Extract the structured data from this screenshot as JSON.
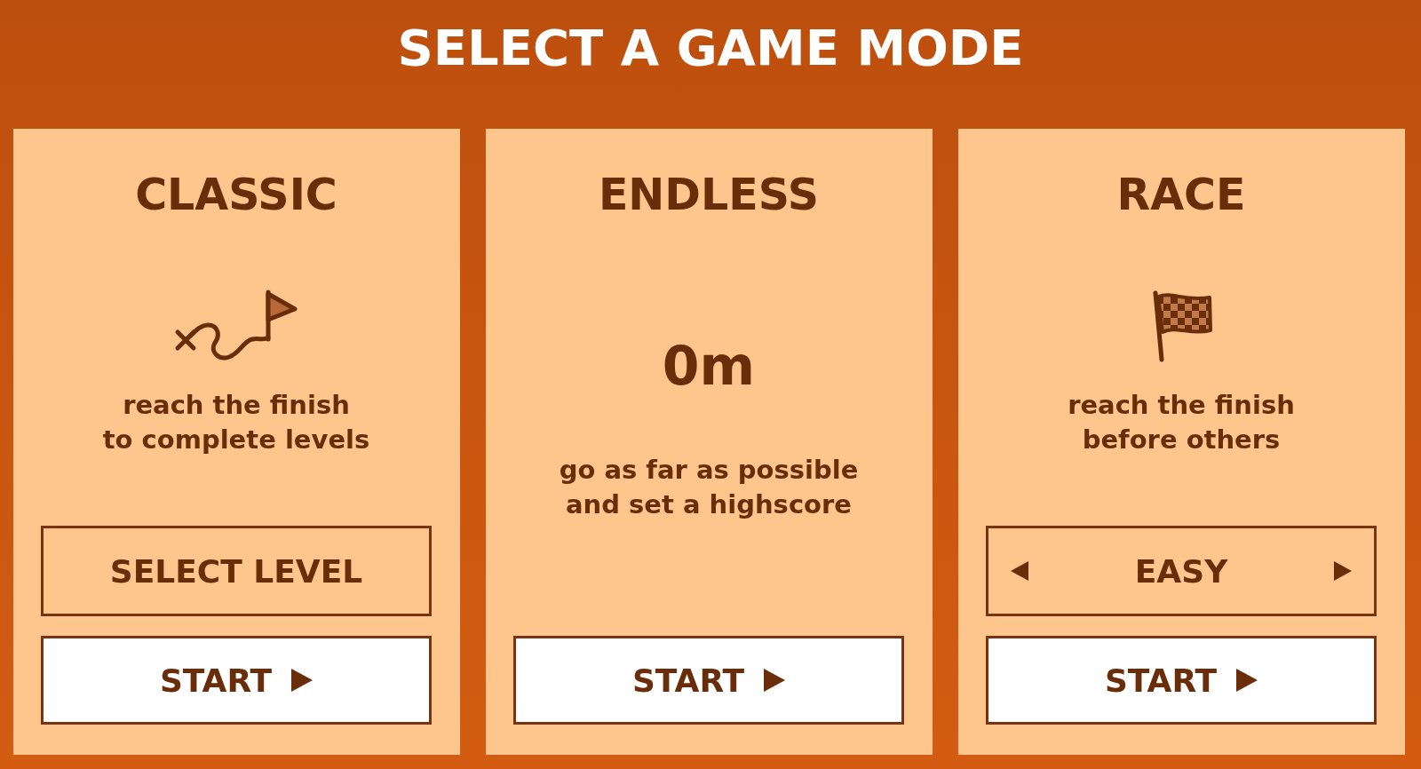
{
  "title": "SELECT A GAME MODE",
  "modes": [
    {
      "kind": "levels",
      "name": "CLASSIC",
      "description": "reach the finish\nto complete levels",
      "level_button": {
        "label": "SELECT LEVEL"
      },
      "start_button": {
        "label": "START"
      }
    },
    {
      "kind": "endless",
      "name": "ENDLESS",
      "distance": "0m",
      "description": "go as far as possible\nand set a highscore",
      "start_button": {
        "label": "START"
      }
    },
    {
      "kind": "race",
      "name": "RACE",
      "description": "reach the finish\nbefore others",
      "difficulty_picker": {
        "value": "EASY"
      },
      "start_button": {
        "label": "START"
      }
    }
  ]
}
